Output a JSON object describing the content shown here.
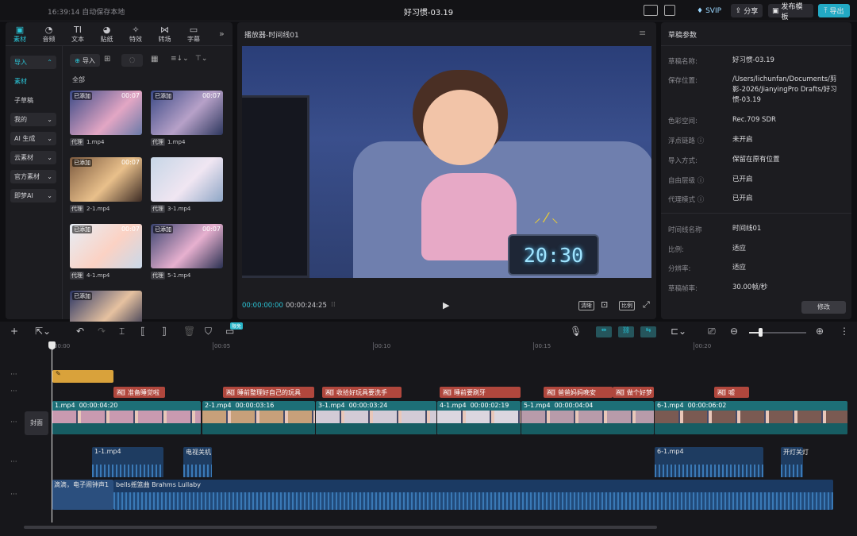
{
  "window": {
    "time": "16:39:14 自动保存本地",
    "title": "好习惯-03.19",
    "svip": "SVIP",
    "share": "分享",
    "publish": "发布模板",
    "export": "导出"
  },
  "toolbar": [
    {
      "icon": "media-icon",
      "label": "素材"
    },
    {
      "icon": "audio-icon",
      "label": "音频"
    },
    {
      "icon": "text-icon",
      "label": "文本"
    },
    {
      "icon": "sticker-icon",
      "label": "贴纸"
    },
    {
      "icon": "effects-icon",
      "label": "特效"
    },
    {
      "icon": "transition-icon",
      "label": "转场"
    },
    {
      "icon": "caption-icon",
      "label": "字幕"
    }
  ],
  "sidebar": [
    {
      "label": "导入",
      "chev": "⌃",
      "box": true,
      "hl": true
    },
    {
      "label": "素材",
      "hl": true
    },
    {
      "label": "子草稿"
    },
    {
      "label": "我的",
      "chev": "⌄",
      "box": true
    },
    {
      "label": "AI 生成",
      "chev": "⌄",
      "box": true
    },
    {
      "label": "云素材",
      "chev": "⌄",
      "box": true
    },
    {
      "label": "官方素材",
      "chev": "⌄",
      "box": true
    },
    {
      "label": "即梦AI",
      "chev": "⌄",
      "box": true
    }
  ],
  "media": {
    "import_label": "导入",
    "all_label": "全部",
    "items": [
      {
        "name": "1.mp4",
        "tag": "已添加",
        "dur": "00:07",
        "proxy": "代理"
      },
      {
        "name": "1.mp4",
        "tag": "已添加",
        "dur": "00:07",
        "proxy": "代理"
      },
      {
        "name": "2-1.mp4",
        "tag": "已添加",
        "dur": "00:07",
        "proxy": "代理"
      },
      {
        "name": "3-1.mp4",
        "tag": "",
        "dur": "",
        "proxy": "代理"
      },
      {
        "name": "4-1.mp4",
        "tag": "已添加",
        "dur": "00:07",
        "proxy": "代理"
      },
      {
        "name": "5-1.mp4",
        "tag": "已添加",
        "dur": "00:07",
        "proxy": "代理"
      },
      {
        "name": "",
        "tag": "已添加",
        "dur": "",
        "proxy": ""
      }
    ]
  },
  "player": {
    "title": "播放器-时间线01",
    "current": "00:00:00:00",
    "total": "00:00:24:25",
    "clock": "20:30",
    "btn_hd": "清晰",
    "btn_ratio": "比例"
  },
  "params": {
    "title": "草稿参数",
    "rows": [
      {
        "label": "草稿名称:",
        "value": "好习惯-03.19"
      },
      {
        "label": "保存位置:",
        "value": "/Users/lichunfan/Documents/剪影-2026/JianyingPro Drafts/好习惯-03.19"
      },
      {
        "label": "色彩空间:",
        "value": "Rec.709 SDR"
      },
      {
        "label": "浮点链路 ⓘ",
        "value": "未开启"
      },
      {
        "label": "导入方式:",
        "value": "保留在原有位置"
      },
      {
        "label": "自由层级 ⓘ",
        "value": "已开启"
      },
      {
        "label": "代理模式 ⓘ",
        "value": "已开启"
      },
      {
        "label": "时间线名称",
        "value": "时间线01"
      },
      {
        "label": "比例:",
        "value": "适应"
      },
      {
        "label": "分辨率:",
        "value": "适应"
      },
      {
        "label": "草稿帧率:",
        "value": "30.00帧/秒"
      }
    ],
    "modify": "修改"
  },
  "timeline": {
    "free_badge": "限免",
    "cover": "封面",
    "ruler": [
      "00:00",
      "00:05",
      "00:10",
      "00:15",
      "00:20"
    ],
    "subtitles": [
      "准备睡觉啦",
      "睡前整理好自己的玩具",
      "收拾好玩具要洗手",
      "睡前要刷牙",
      "爸爸妈妈晚安",
      "做个好梦",
      "嘘"
    ],
    "clips": [
      {
        "name": "1.mp4",
        "dur": "00:00:04:20"
      },
      {
        "name": "2-1.mp4",
        "dur": "00:00:03:16"
      },
      {
        "name": "3-1.mp4",
        "dur": "00:00:03:24"
      },
      {
        "name": "4-1.mp4",
        "dur": "00:00:02:19"
      },
      {
        "name": "5-1.mp4",
        "dur": "00:00:04:04"
      },
      {
        "name": "6-1.mp4",
        "dur": "00:00:06:02"
      }
    ],
    "audio": [
      {
        "name": "1-1.mp4"
      },
      {
        "name": "电视关机"
      },
      {
        "name": "6-1.mp4"
      },
      {
        "name": "开灯关灯"
      }
    ],
    "music": {
      "sfx": "滴滴，电子闹钟声1",
      "song": "bells摇篮曲  Brahms Lullaby"
    }
  }
}
